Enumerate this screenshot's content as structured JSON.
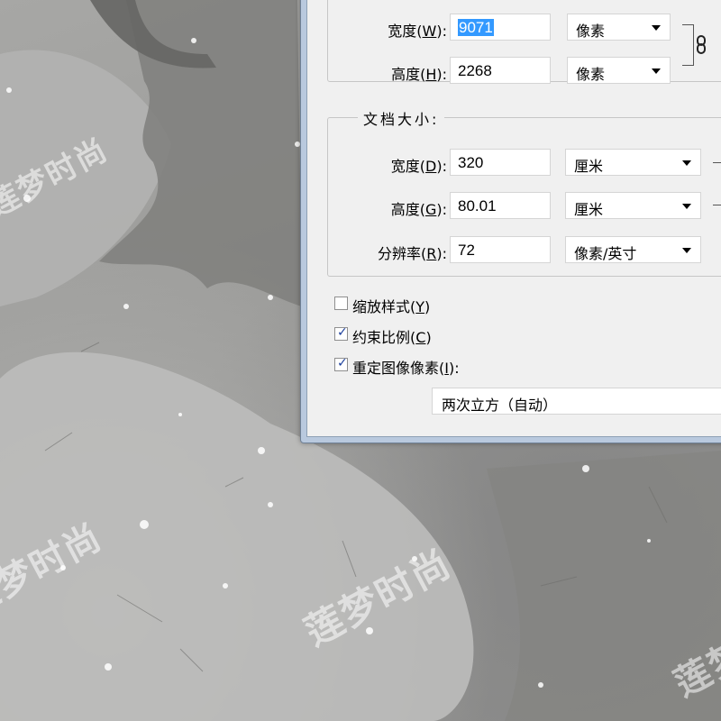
{
  "pixel_dimensions": {
    "width_label": "宽度",
    "width_key": "W",
    "width_value": "9071",
    "width_unit": "像素",
    "height_label": "高度",
    "height_key": "H",
    "height_value": "2268",
    "height_unit": "像素"
  },
  "document_size": {
    "title": "文档大小:",
    "width_label": "宽度",
    "width_key": "D",
    "width_value": "320",
    "width_unit": "厘米",
    "height_label": "高度",
    "height_key": "G",
    "height_value": "80.01",
    "height_unit": "厘米",
    "resolution_label": "分辨率",
    "resolution_key": "R",
    "resolution_value": "72",
    "resolution_unit": "像素/英寸"
  },
  "options": {
    "scale_styles_label": "缩放样式",
    "scale_styles_key": "Y",
    "scale_styles_checked": false,
    "constrain_label": "约束比例",
    "constrain_key": "C",
    "constrain_checked": true,
    "resample_label": "重定图像像素",
    "resample_key": "I",
    "resample_checked": true,
    "resample_method": "两次立方（自动）"
  },
  "background": {
    "watermark_text": "莲梦时尚"
  },
  "icons": {
    "link": "chain-link-icon",
    "dropdown": "chevron-down-icon",
    "check": "checkmark-icon"
  },
  "colors": {
    "selection": "#3399ff",
    "dialog_frame": "#b9c9de",
    "dialog_body": "#f0f0f0"
  }
}
